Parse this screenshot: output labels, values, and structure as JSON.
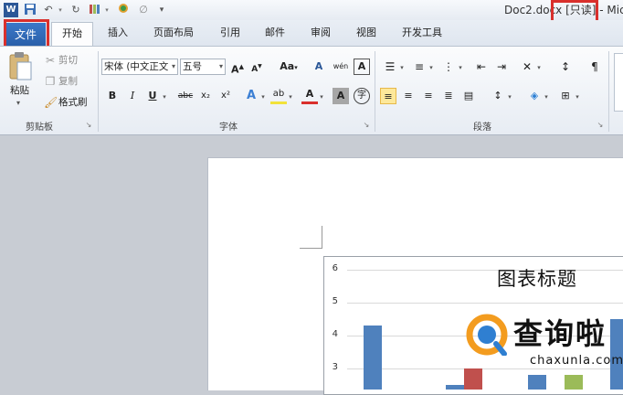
{
  "titlebar": {
    "doc_title": "Doc2.docx [只读] - Mic",
    "word_icon": "W",
    "save_icon": "save-icon",
    "undo_icon": "undo-icon",
    "redo_icon": "redo-icon",
    "customize_icon": "customize-qat-icon"
  },
  "tabs": {
    "file": "文件",
    "home": "开始",
    "items": [
      "插入",
      "页面布局",
      "引用",
      "邮件",
      "审阅",
      "视图",
      "开发工具"
    ]
  },
  "ribbon": {
    "clipboard": {
      "paste": "粘贴",
      "cut": "剪切",
      "copy": "复制",
      "format_painter": "格式刷",
      "group_label": "剪贴板"
    },
    "font": {
      "font_name": "宋体 (中文正文",
      "font_size": "五号",
      "grow": "A",
      "shrink": "A",
      "change_case": "Aa",
      "clear_format": "A",
      "pinyin": "wén",
      "char_border": "A",
      "bold": "B",
      "italic": "I",
      "underline": "U",
      "strike": "abc",
      "sub": "x₂",
      "sup": "x²",
      "text_effect": "A",
      "highlight": "ab",
      "font_color": "A",
      "char_shading": "A",
      "enclose": "字",
      "group_label": "字体"
    },
    "paragraph": {
      "group_label": "段落"
    },
    "accent_color": "#2b5797"
  },
  "chart": {
    "y_ticks": [
      "6",
      "5",
      "4",
      "3"
    ],
    "title": "图表标题"
  },
  "chart_data": {
    "type": "bar",
    "title": "图表标题",
    "ylim": [
      2.5,
      6
    ],
    "series": [
      {
        "color": "#4f81bd",
        "values": [
          4.3,
          2.5,
          2.8,
          4.5
        ]
      },
      {
        "color": "#c0504d",
        "values": [
          null,
          3.0,
          null,
          null
        ]
      },
      {
        "color": "#9bbb59",
        "values": [
          null,
          null,
          2.8,
          null
        ]
      }
    ]
  },
  "watermark": {
    "text": "查询啦",
    "sub": "chaxunla.com"
  }
}
